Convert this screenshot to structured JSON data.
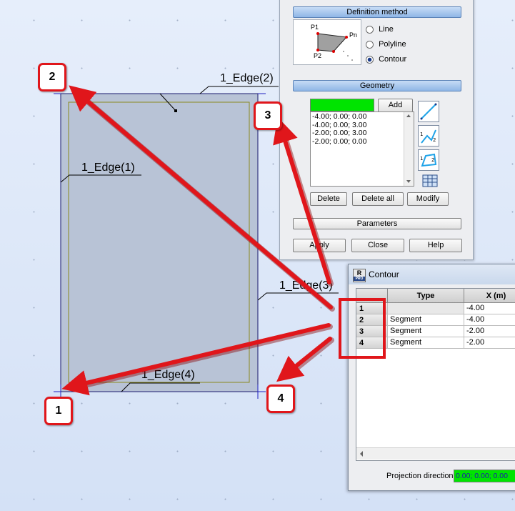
{
  "canvas": {
    "edges": {
      "e1": "1_Edge(1)",
      "e2": "1_Edge(2)",
      "e3": "1_Edge(3)",
      "e4": "1_Edge(4)"
    }
  },
  "definition_dialog": {
    "section_definition": "Definition method",
    "preview_labels": {
      "p1": "P1",
      "pn": "Pn",
      "p2": "P2"
    },
    "radio_options": [
      {
        "label": "Line",
        "selected": false
      },
      {
        "label": "Polyline",
        "selected": false
      },
      {
        "label": "Contour",
        "selected": true
      }
    ],
    "section_geometry": "Geometry",
    "input_color": "#00e400",
    "add_label": "Add",
    "points": [
      "-4.00; 0.00; 0.00",
      "-4.00; 0.00; 3.00",
      "-2.00; 0.00; 3.00",
      "-2.00; 0.00; 0.00"
    ],
    "delete_label": "Delete",
    "delete_all_label": "Delete all",
    "modify_label": "Modify",
    "parameters_label": "Parameters",
    "apply_label": "Apply",
    "close_label": "Close",
    "help_label": "Help",
    "icons": [
      "line-tool-icon",
      "polyline-tool-icon",
      "contour-tool-icon",
      "table-icon"
    ]
  },
  "contour_dialog": {
    "app_icon_text": "R",
    "app_icon_sub": "PRO",
    "title": "Contour",
    "columns": [
      "Type",
      "X (m)"
    ],
    "rows": [
      {
        "n": "1",
        "type": "",
        "x": "-4.00"
      },
      {
        "n": "2",
        "type": "Segment",
        "x": "-4.00"
      },
      {
        "n": "3",
        "type": "Segment",
        "x": "-2.00"
      },
      {
        "n": "4",
        "type": "Segment",
        "x": "-2.00"
      }
    ],
    "projection_label": "Projection direction",
    "projection_value": "0.00; 0.00; 0.00",
    "projection_color": "#00e400"
  },
  "callouts": [
    "1",
    "2",
    "3",
    "4"
  ],
  "colors": {
    "accent_red": "#e0161b",
    "panel_fill": "#b8c3d6"
  }
}
